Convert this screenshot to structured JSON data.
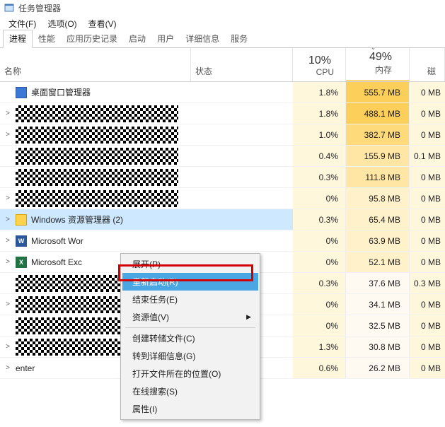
{
  "window": {
    "title": "任务管理器"
  },
  "menubar": {
    "file": "文件(F)",
    "options": "选项(O)",
    "view": "查看(V)"
  },
  "tabs": {
    "processes": "进程",
    "performance": "性能",
    "app_history": "应用历史记录",
    "startup": "启动",
    "users": "用户",
    "details": "详细信息",
    "services": "服务"
  },
  "columns": {
    "name": "名称",
    "status": "状态",
    "cpu_pct": "10%",
    "cpu_label": "CPU",
    "mem_pct": "49%",
    "mem_label": "内存",
    "disk_label": "磁"
  },
  "rows": [
    {
      "name": "桌面窗口管理器",
      "icon": "blue-square",
      "cpu": "1.8%",
      "mem": "555.7 MB",
      "disk": "0 MB",
      "cpu_shade": 2,
      "mem_shade": 4,
      "expander": ""
    },
    {
      "redacted": true,
      "cpu": "1.8%",
      "mem": "488.1 MB",
      "disk": "0 MB",
      "cpu_shade": 2,
      "mem_shade": 4,
      "expander": ">"
    },
    {
      "redacted": true,
      "cpu": "1.0%",
      "mem": "382.7 MB",
      "disk": "0 MB",
      "cpu_shade": 1,
      "mem_shade": 3,
      "expander": ">",
      "tall": true
    },
    {
      "redacted": true,
      "cpu": "0.4%",
      "mem": "155.9 MB",
      "disk": "0.1 MB",
      "cpu_shade": 1,
      "mem_shade": 2,
      "expander": ""
    },
    {
      "redacted": true,
      "cpu": "0.3%",
      "mem": "111.8 MB",
      "disk": "0 MB",
      "cpu_shade": 1,
      "mem_shade": 2,
      "expander": "",
      "mid": true
    },
    {
      "redacted": true,
      "cpu": "0%",
      "mem": "95.8 MB",
      "disk": "0 MB",
      "cpu_shade": 0,
      "mem_shade": 1,
      "expander": ">"
    },
    {
      "name": "Windows 资源管理器 (2)",
      "icon": "folder",
      "cpu": "0.3%",
      "mem": "65.4 MB",
      "disk": "0 MB",
      "cpu_shade": 1,
      "mem_shade": 1,
      "expander": ">",
      "selected": true
    },
    {
      "name": "Microsoft Wor",
      "icon": "word",
      "cpu": "0%",
      "mem": "63.9 MB",
      "disk": "0 MB",
      "cpu_shade": 0,
      "mem_shade": 1,
      "expander": ">"
    },
    {
      "name": "Microsoft Exc",
      "icon": "excel",
      "cpu": "0%",
      "mem": "52.1 MB",
      "disk": "0 MB",
      "cpu_shade": 0,
      "mem_shade": 1,
      "expander": ">"
    },
    {
      "redacted": true,
      "cpu": "0.3%",
      "mem": "37.6 MB",
      "disk": "0.3 MB",
      "cpu_shade": 1,
      "mem_shade": 0,
      "expander": ""
    },
    {
      "redacted": true,
      "cpu": "0%",
      "mem": "34.1 MB",
      "disk": "0 MB",
      "cpu_shade": 0,
      "mem_shade": 0,
      "expander": ">",
      "tall": true
    },
    {
      "redacted": true,
      "cpu": "0%",
      "mem": "32.5 MB",
      "disk": "0 MB",
      "cpu_shade": 0,
      "mem_shade": 0,
      "expander": ""
    },
    {
      "redacted": true,
      "cpu": "1.3%",
      "mem": "30.8 MB",
      "disk": "0 MB",
      "cpu_shade": 2,
      "mem_shade": 0,
      "expander": ">",
      "mid": true
    },
    {
      "name": "enter",
      "cpu": "0.6%",
      "mem": "26.2 MB",
      "disk": "0 MB",
      "cpu_shade": 1,
      "mem_shade": 0,
      "expander": ">"
    }
  ],
  "context_menu": {
    "expand": "展开(P)",
    "restart": "重新启动(R)",
    "end_task": "结束任务(E)",
    "resource_values": "资源值(V)",
    "create_dump": "创建转储文件(C)",
    "go_details": "转到详细信息(G)",
    "open_location": "打开文件所在的位置(O)",
    "search_online": "在线搜索(S)",
    "properties": "属性(I)"
  }
}
